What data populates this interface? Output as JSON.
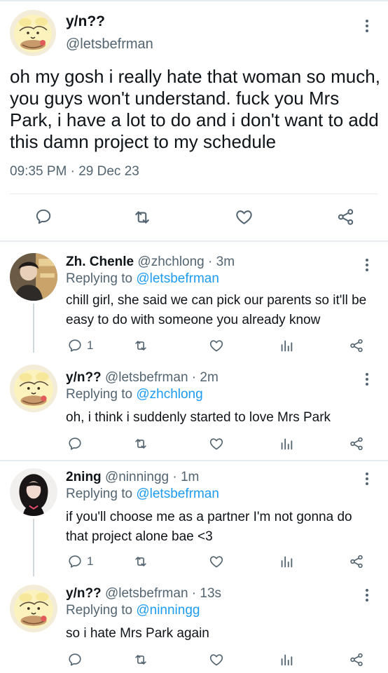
{
  "main_tweet": {
    "name": "y/n??",
    "handle": "@letsbefrman",
    "text": "oh my gosh i really hate that woman so much, you guys won't understand. fuck you Mrs Park, i have a lot to do and i don't want to add this damn project to my schedule",
    "timestamp": "09:35 PM · 29 Dec 23"
  },
  "replies": [
    {
      "name": "Zh. Chenle",
      "handle": "@zhchlong · 3m",
      "replying_prefix": "Replying to ",
      "replying_to": "@letsbefrman",
      "text": "chill girl, she said we can pick our parents so it'll be easy to do with someone you already know",
      "reply_count": "1"
    },
    {
      "name": "y/n??",
      "handle": "@letsbefrman · 2m",
      "replying_prefix": "Replying to ",
      "replying_to": "@zhchlong",
      "text": "oh, i think i suddenly started to love Mrs Park",
      "reply_count": ""
    },
    {
      "name": "2ning",
      "handle": "@ninningg · 1m",
      "replying_prefix": "Replying to ",
      "replying_to": "@letsbefrman",
      "text": "if you'll choose me as a partner I'm not gonna do that project alone bae <3",
      "reply_count": "1"
    },
    {
      "name": "y/n??",
      "handle": "@letsbefrman · 13s",
      "replying_prefix": "Replying to ",
      "replying_to": "@ninningg",
      "text": "so i hate Mrs Park again",
      "reply_count": ""
    }
  ],
  "icons": {
    "reply": "reply-icon",
    "retweet": "retweet-icon",
    "like": "heart-icon",
    "views": "views-icon",
    "share": "share-icon",
    "more": "more-icon"
  },
  "colors": {
    "accent": "#1d9bf0",
    "secondary_text": "#536471",
    "divider": "#e6ecf0"
  }
}
